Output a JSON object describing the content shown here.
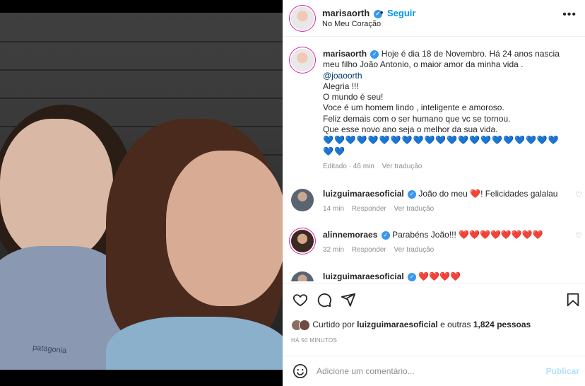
{
  "header": {
    "username": "marisaorth",
    "dot": "•",
    "follow_label": "Seguir",
    "location": "No Meu Coração",
    "more_icon": "more-horizontal-icon"
  },
  "photo": {
    "shirt_text": "patagonia"
  },
  "caption": {
    "username": "marisaorth",
    "line1": "Hoje é dia 18 de Novembro. Há 24 anos nascia meu filho João Antonio, o maior amor da minha vida .",
    "mention": "@joaoorth",
    "line2": "Alegria !!!",
    "line3": "O mundo é seu!",
    "line4": "Voce é um homem lindo , inteligente e amoroso.",
    "line5": "Feliz demais com o ser humano que vc se tornou.",
    "line6": "Que esse novo ano seja o melhor da sua vida.",
    "hearts": "💙💙💙💙💙💙💙💙💙💙💙💙💙💙💙💙💙💙💙💙💙💙💙",
    "edited": "Editado · 46 min",
    "translate": "Ver tradução"
  },
  "comments": [
    {
      "username": "luizguimaraesoficial",
      "text_before": "João do meu ",
      "heart": "❤️",
      "text_after": "! Felicidades galalau",
      "time": "14 min",
      "reply": "Responder",
      "translate": "Ver tradução"
    },
    {
      "username": "alinnemoraes",
      "text_before": "Parabéns João!!! ",
      "heart": "❤️❤️❤️❤️❤️❤️❤️❤️",
      "text_after": "",
      "time": "32 min",
      "reply": "Responder",
      "translate": "Ver tradução"
    },
    {
      "username": "luizguimaraesoficial",
      "text_before": "",
      "heart": "❤️❤️❤️❤️",
      "text_after": ""
    }
  ],
  "likes": {
    "prefix": "Curtido por",
    "user": "luizguimaraesoficial",
    "middle": "e outras",
    "count": "1,824",
    "suffix": "pessoas"
  },
  "timestamp": "HÁ 50 MINUTOS",
  "add_comment": {
    "placeholder": "Adicione um comentário...",
    "publish": "Publicar"
  },
  "icons": [
    "heart-icon",
    "comment-icon",
    "share-icon",
    "bookmark-icon",
    "emoji-icon",
    "verified-badge-icon"
  ],
  "colors": {
    "link": "#0095f6",
    "verified": "#3897f0",
    "heart_red": "#ed4956",
    "heart_blue": "#1e88e5"
  }
}
